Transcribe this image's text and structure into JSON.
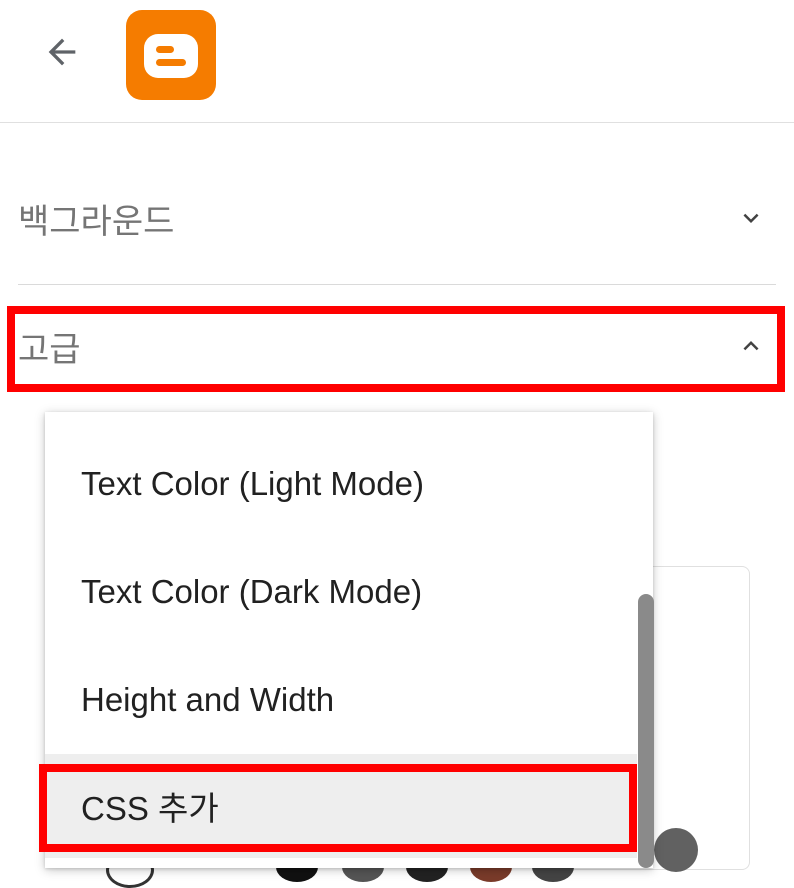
{
  "header": {
    "back_icon": "arrow-back-icon",
    "logo": "blogger-logo",
    "brand_color": "#f57c00"
  },
  "sections": [
    {
      "title": "백그라운드",
      "state": "collapsed",
      "icon": "chevron-down-icon"
    },
    {
      "title": "고급",
      "state": "expanded",
      "icon": "chevron-up-icon"
    }
  ],
  "dropdown": {
    "items": [
      {
        "label": "Text Color (Light Mode)"
      },
      {
        "label": "Text Color (Dark Mode)"
      },
      {
        "label": "Height and Width"
      },
      {
        "label": "CSS 추가",
        "selected": true
      }
    ]
  },
  "colors": {
    "highlight": "#ff0000",
    "selected_bg": "#eeeeee"
  }
}
